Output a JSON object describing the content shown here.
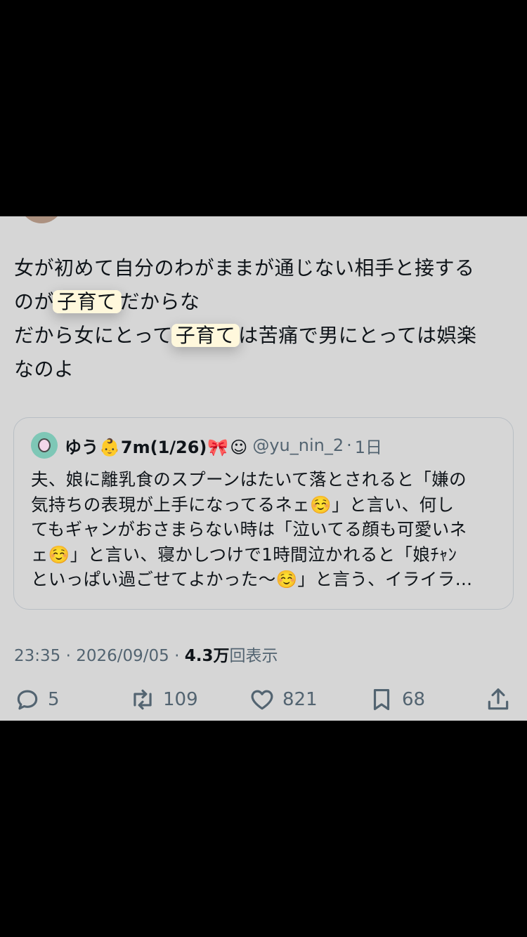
{
  "tweet": {
    "text_line1": "女が初めて自分のわがままが通じない相手と接する",
    "text_line2_pre": "のが",
    "highlight1": "子育て",
    "text_line2_post": "だからな",
    "text_line3_pre": "だから女にとって",
    "highlight2": "子育て",
    "text_line3_post": "は苦痛で男にとっては娯楽",
    "text_line4": "なのよ"
  },
  "quote": {
    "name": "ゆう",
    "name_emoji1": "👶",
    "name_suffix": "7m(1/26)",
    "name_emoji2": "🎀",
    "name_emoji3": "☺",
    "handle": "@yu_nin_2",
    "separator": "·",
    "time": "1日",
    "body": "夫、娘に離乳食のスプーンはたいて落とされると「嫌の\n気持ちの表現が上手になってるネェ☺️」と言い、何し\nてもギャンがおさまらない時は「泣いてる顔も可愛いネ\nェ☺️」と言い、寝かしつけで1時間泣かれると「娘ﾁｬﾝ\nといっぱい過ごせてよかった〜☺️」と言う、イライラ…"
  },
  "meta": {
    "time": "23:35",
    "dot1": "·",
    "date": "2026/09/05",
    "dot2": "·",
    "views_count": "4.3万",
    "views_label": "回表示"
  },
  "actions": {
    "replies": "5",
    "reposts": "109",
    "likes": "821",
    "bookmarks": "68"
  },
  "icons": {
    "reply": "reply-icon",
    "repost": "repost-icon",
    "like": "heart-icon",
    "bookmark": "bookmark-icon",
    "share": "share-icon"
  }
}
